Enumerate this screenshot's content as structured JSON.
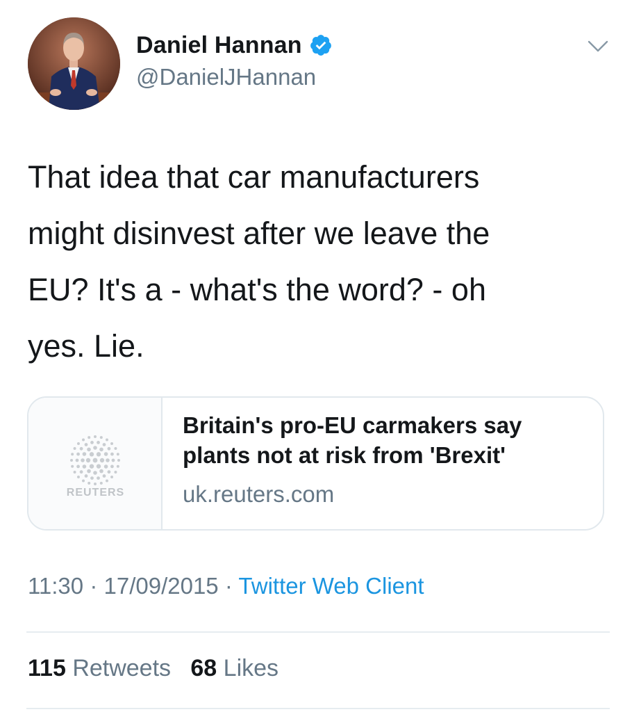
{
  "author": {
    "display_name": "Daniel Hannan",
    "handle": "@DanielJHannan",
    "verified": true
  },
  "tweet": {
    "text": "That idea that car manufacturers\nmight disinvest after we leave the\nEU? It's a - what's the word? - oh\nyes. Lie."
  },
  "card": {
    "title": "Britain's pro-EU carmakers say plants not at risk from 'Brexit'",
    "domain": "uk.reuters.com",
    "thumbnail_label": "REUTERS"
  },
  "meta": {
    "time": "11:30",
    "separator": "·",
    "date": "17/09/2015",
    "source": "Twitter Web Client"
  },
  "stats": {
    "retweets_count": "115",
    "retweets_label": "Retweets",
    "likes_count": "68",
    "likes_label": "Likes"
  },
  "colors": {
    "text": "#14171a",
    "secondary": "#657786",
    "accent": "#1b95e0",
    "border": "#e1e8ed"
  },
  "icons": {
    "verified": "verified-badge-icon",
    "menu": "chevron-down-icon",
    "thumbnail": "reuters-logo-icon"
  }
}
